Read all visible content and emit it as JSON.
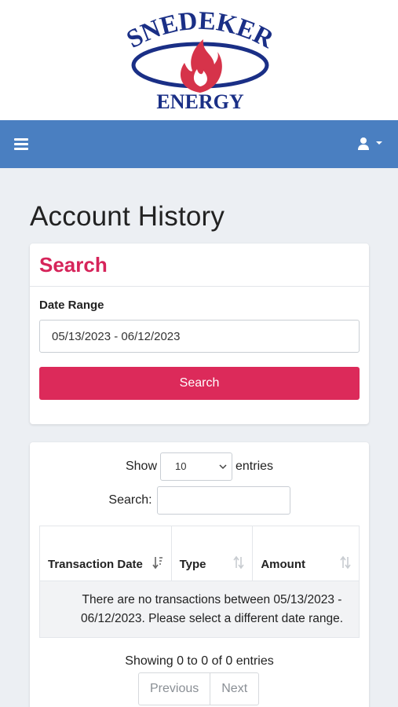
{
  "logo": {
    "top_text": "SNEDEKER",
    "bottom_text": "ENERGY"
  },
  "header": {
    "menu_icon": "hamburger-icon",
    "user_icon": "user-icon"
  },
  "page": {
    "title": "Account History"
  },
  "search_panel": {
    "title": "Search",
    "date_range_label": "Date Range",
    "date_range_value": "05/13/2023 - 06/12/2023",
    "search_button": "Search"
  },
  "table_controls": {
    "show_label": "Show",
    "entries_label": "entries",
    "page_length": "10",
    "search_label": "Search:"
  },
  "table": {
    "columns": [
      "Transaction Date",
      "Type",
      "Amount"
    ],
    "empty_message": "There are no transactions between 05/13/2023 - 06/12/2023. Please select a different date range."
  },
  "footer": {
    "info": "Showing 0 to 0 of 0 entries",
    "previous": "Previous",
    "next": "Next"
  },
  "colors": {
    "navbar": "#4a7fc1",
    "accent": "#dc2a5a",
    "logo_blue": "#1a2f86",
    "logo_red": "#d6334a"
  }
}
